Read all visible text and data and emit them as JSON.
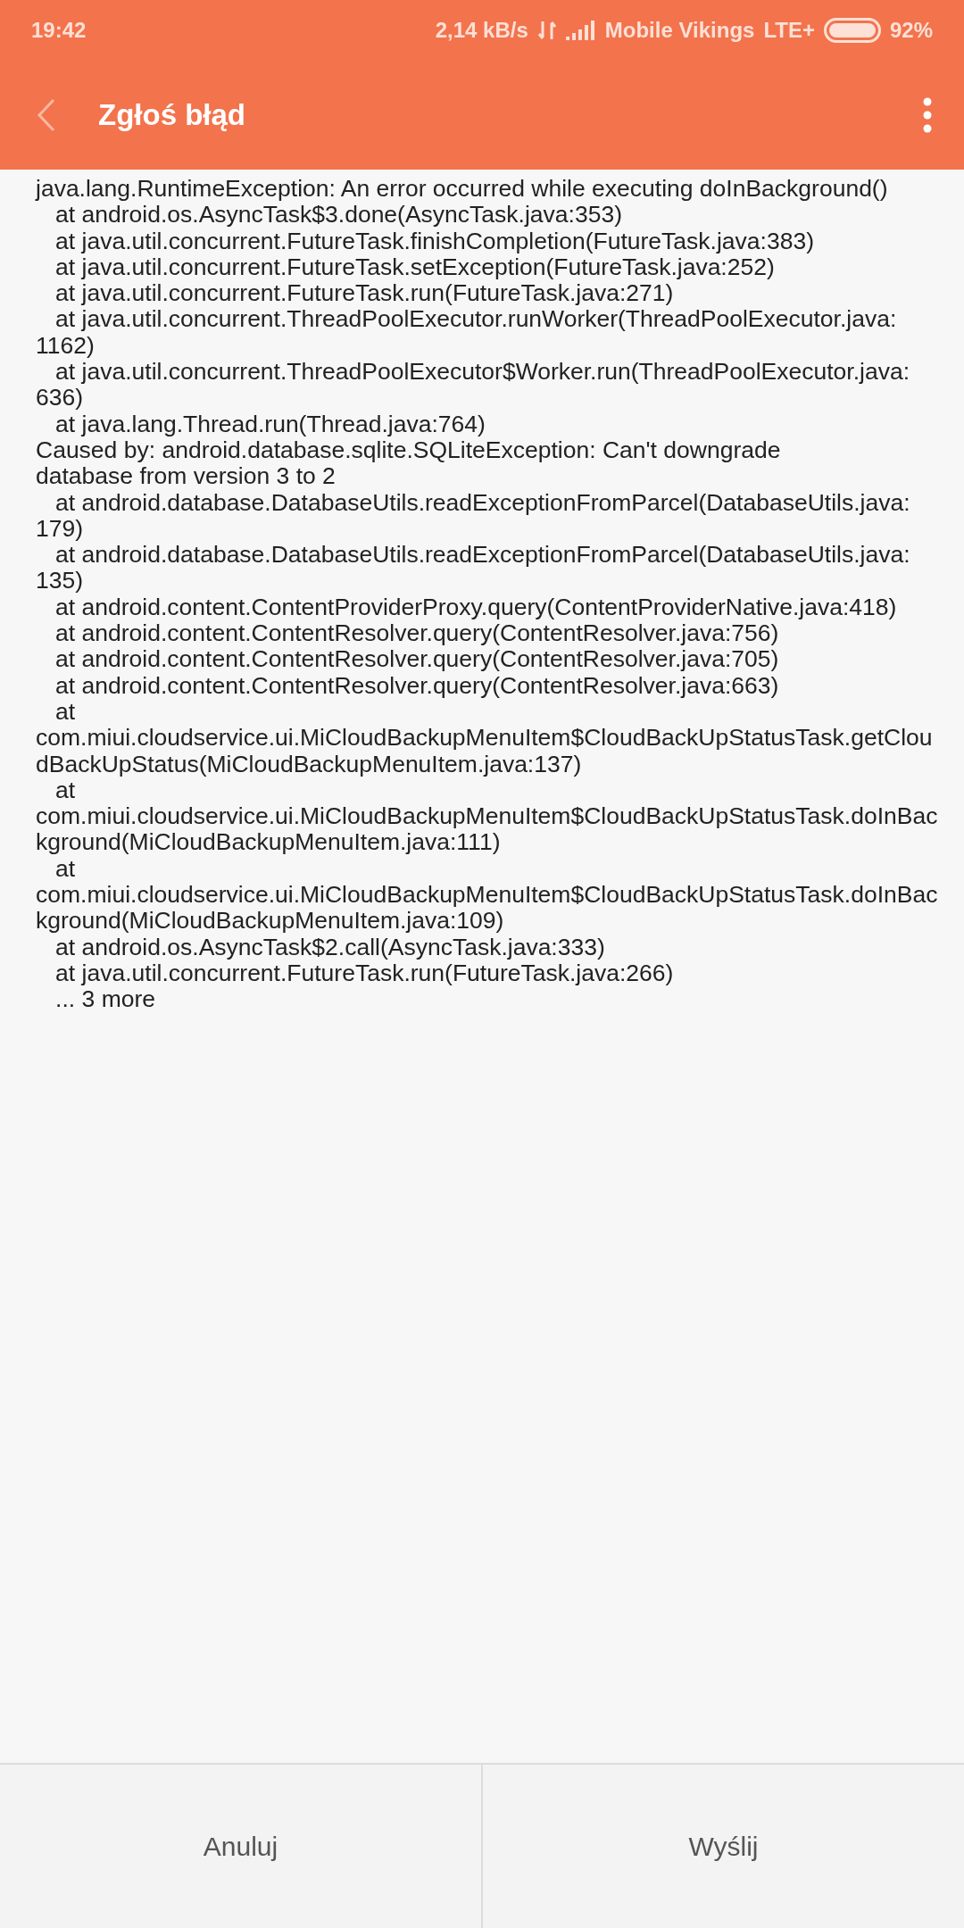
{
  "status_bar": {
    "time": "19:42",
    "speed": "2,14 kB/s",
    "carrier": "Mobile Vikings",
    "network": "LTE+",
    "battery": "92%"
  },
  "header": {
    "title": "Zgłoś błąd"
  },
  "log_lines": [
    "java.lang.RuntimeException: An error occurred while executing doInBackground()",
    "   at android.os.AsyncTask$3.done(AsyncTask.java:353)",
    "   at java.util.concurrent.FutureTask.finishCompletion(FutureTask.java:383)",
    "   at java.util.concurrent.FutureTask.setException(FutureTask.java:252)",
    "   at java.util.concurrent.FutureTask.run(FutureTask.java:271)",
    "   at java.util.concurrent.ThreadPoolExecutor.runWorker(ThreadPoolExecutor.java:",
    "1162)",
    "   at java.util.concurrent.ThreadPoolExecutor$Worker.run(ThreadPoolExecutor.java:",
    "636)",
    "   at java.lang.Thread.run(Thread.java:764)",
    "Caused by: android.database.sqlite.SQLiteException: Can't downgrade",
    "database from version 3 to 2",
    "   at android.database.DatabaseUtils.readExceptionFromParcel(DatabaseUtils.java:",
    "179)",
    "   at android.database.DatabaseUtils.readExceptionFromParcel(DatabaseUtils.java:",
    "135)",
    "   at android.content.ContentProviderProxy.query(ContentProviderNative.java:418)",
    "   at android.content.ContentResolver.query(ContentResolver.java:756)",
    "   at android.content.ContentResolver.query(ContentResolver.java:705)",
    "   at android.content.ContentResolver.query(ContentResolver.java:663)",
    "   at",
    "com.miui.cloudservice.ui.MiCloudBackupMenuItem$CloudBackUpStatusTask.getClou",
    "dBackUpStatus(MiCloudBackupMenuItem.java:137)",
    "   at",
    "com.miui.cloudservice.ui.MiCloudBackupMenuItem$CloudBackUpStatusTask.doInBac",
    "kground(MiCloudBackupMenuItem.java:111)",
    "   at",
    "com.miui.cloudservice.ui.MiCloudBackupMenuItem$CloudBackUpStatusTask.doInBac",
    "kground(MiCloudBackupMenuItem.java:109)",
    "   at android.os.AsyncTask$2.call(AsyncTask.java:333)",
    "   at java.util.concurrent.FutureTask.run(FutureTask.java:266)",
    "   ... 3 more"
  ],
  "buttons": [
    "Anuluj",
    "Wyślij"
  ]
}
